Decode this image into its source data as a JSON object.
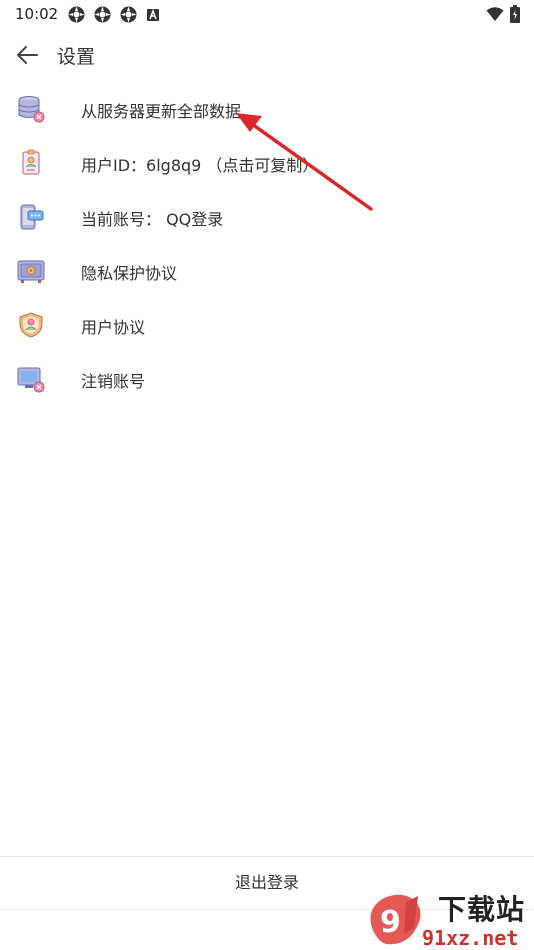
{
  "status_bar": {
    "time": "10:02",
    "notification_icons": [
      "notification-app-icon",
      "notification-app-icon",
      "notification-app-icon",
      "notification-a-icon"
    ],
    "signal_icons": [
      "wifi-icon",
      "battery-charging-icon"
    ]
  },
  "header": {
    "title": "设置",
    "back_icon": "back-arrow-icon"
  },
  "settings": {
    "items": [
      {
        "label": "从服务器更新全部数据",
        "icon": "database-sync-icon"
      },
      {
        "label": "用户ID：6lg8q9 （点击可复制）",
        "icon": "id-badge-icon"
      },
      {
        "label": "当前账号：  QQ登录",
        "icon": "phone-chat-icon"
      },
      {
        "label": "隐私保护协议",
        "icon": "safe-lock-icon"
      },
      {
        "label": "用户协议",
        "icon": "shield-user-icon"
      },
      {
        "label": "注销账号",
        "icon": "monitor-delete-icon"
      }
    ]
  },
  "footer": {
    "logout_label": "退出登录"
  },
  "watermark": {
    "text_top": "下载站",
    "text_bottom": "91xz.net"
  },
  "colors": {
    "text": "#333333",
    "divider": "#e6e6e6",
    "annotation": "#d9262b",
    "icon_purple": "#8a8ae0",
    "icon_orange": "#f5b77a",
    "icon_pink": "#f08bb0"
  }
}
